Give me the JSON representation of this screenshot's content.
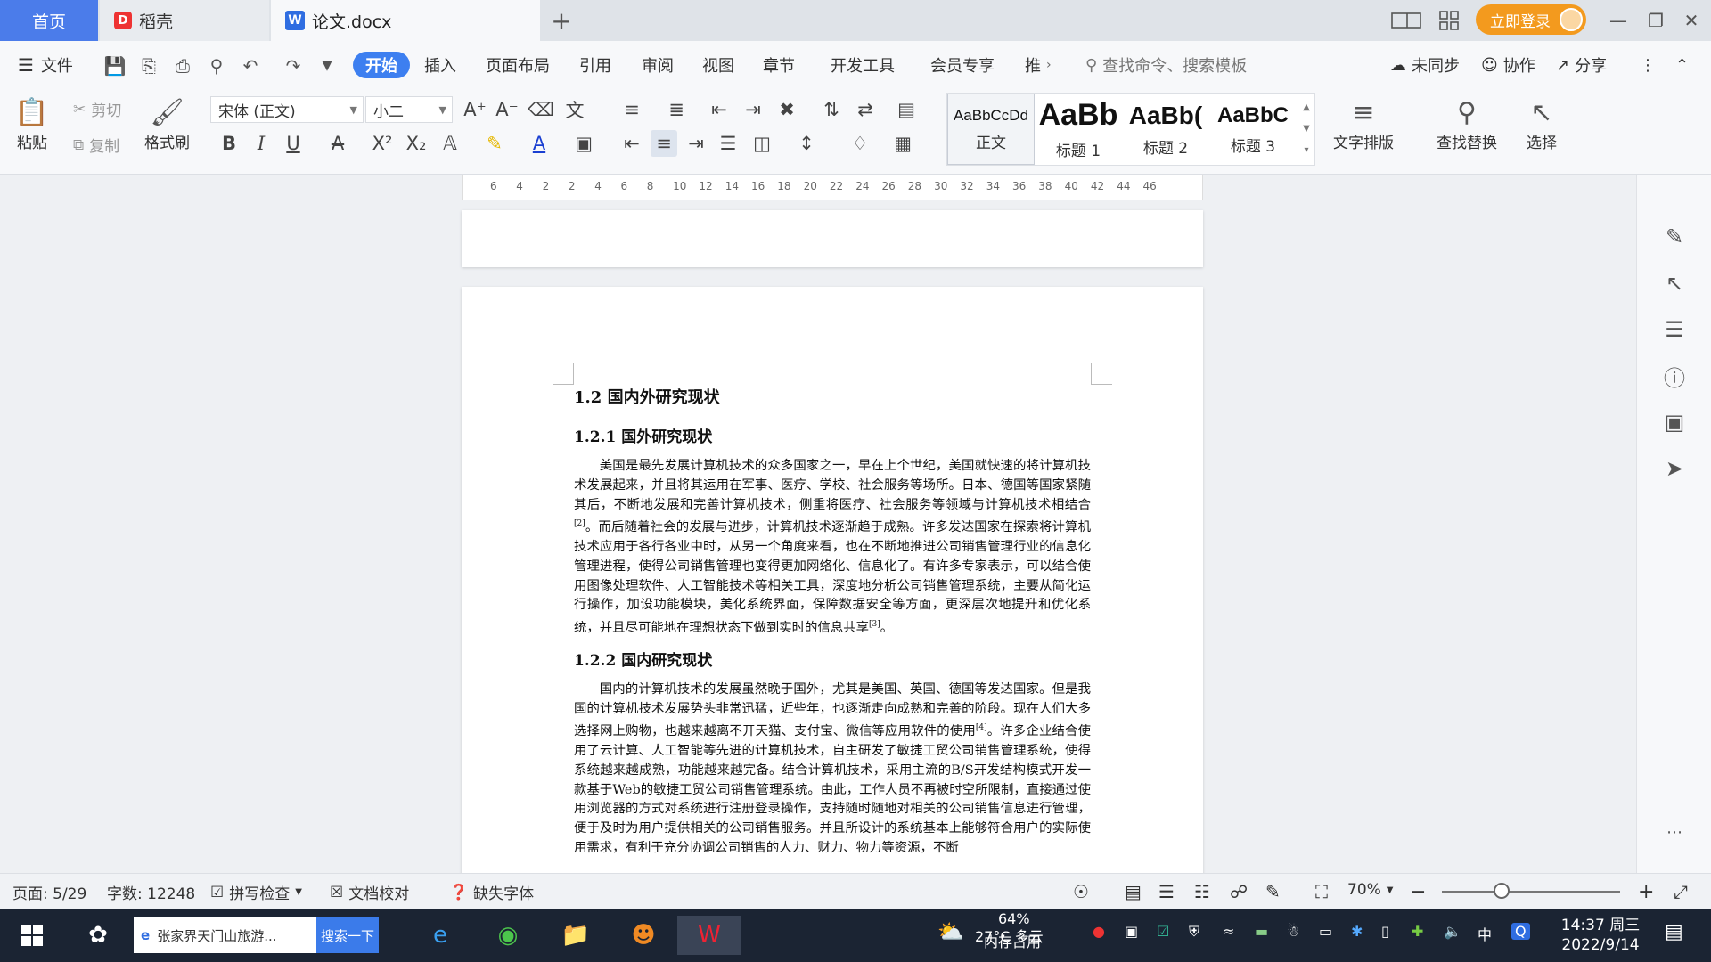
{
  "tabs": {
    "home": "首页",
    "daoke": "稻壳",
    "doc": "论文.docx"
  },
  "titlebar": {
    "login": "立即登录"
  },
  "menu": {
    "file": "文件",
    "start": "开始",
    "insert": "插入",
    "layout": "页面布局",
    "reference": "引用",
    "review": "审阅",
    "view": "视图",
    "chapter": "章节",
    "devtools": "开发工具",
    "member": "会员专享",
    "more": "推",
    "search_cmd": "查找命令、搜索模板",
    "unsync": "未同步",
    "collab": "协作",
    "share": "分享"
  },
  "ribbon": {
    "paste": "粘贴",
    "cut": "剪切",
    "copy": "复制",
    "format_painter": "格式刷",
    "font_name": "宋体 (正文)",
    "font_size": "小二",
    "styles": [
      {
        "sample": "AaBbCcDd",
        "name": "正文"
      },
      {
        "sample": "AaBb",
        "name": "标题 1"
      },
      {
        "sample": "AaBb(",
        "name": "标题 2"
      },
      {
        "sample": "AaBbC",
        "name": "标题 3"
      }
    ],
    "text_layout": "文字排版",
    "find_replace": "查找替换",
    "select": "选择"
  },
  "ruler": {
    "ticks": [
      "6",
      "4",
      "2",
      "2",
      "4",
      "6",
      "8",
      "10",
      "12",
      "14",
      "16",
      "18",
      "20",
      "22",
      "24",
      "26",
      "28",
      "30",
      "32",
      "34",
      "36",
      "38",
      "40",
      "42",
      "44",
      "46"
    ]
  },
  "document": {
    "h_1_2": "1.2 国内外研究现状",
    "h_1_2_1": "1.2.1 国外研究现状",
    "p1_a": "美国是最先发展计算机技术的众多国家之一，早在上个世纪，美国就快速的将计算机技术发展起来，并且将其运用在军事、医疗、学校、社会服务等场所。日本、德国等国家紧随其后，不断地发展和完善计算机技术，侧重将医疗、社会服务等领域与计算机技术相结合",
    "p1_ref1": "[2]",
    "p1_b": "。而后随着社会的发展与进步，计算机技术逐渐趋于成熟。许多发达国家在探索将计算机技术应用于各行各业中时，从另一个角度来看，也在不断地推进公司销售管理行业的信息化管理进程，使得公司销售管理也变得更加网络化、信息化了。有许多专家表示，可以结合使用图像处理软件、人工智能技术等相关工具，深度地分析公司销售管理系统，主要从简化运行操作，加设功能模块，美化系统界面，保障数据安全等方面，更深层次地提升和优化系统，并且尽可能地在理想状态下做到实时的信息共享",
    "p1_ref2": "[3]",
    "p1_c": "。",
    "h_1_2_2": "1.2.2 国内研究现状",
    "p2_a": "国内的计算机技术的发展虽然晚于国外，尤其是美国、英国、德国等发达国家。但是我国的计算机技术发展势头非常迅猛，近些年，也逐渐走向成熟和完善的阶段。现在人们大多选择网上购物，也越来越离不开天猫、支付宝、微信等应用软件的使用",
    "p2_ref1": "[4]",
    "p2_b": "。许多企业结合使用了云计算、人工智能等先进的计算机技术，自主研发了敏捷工贸公司销售管理系统，使得系统越来越成熟，功能越来越完备。结合计算机技术，采用主流的B/S开发结构模式开发一款基于Web的敏捷工贸公司销售管理系统。由此，工作人员不再被时空所限制，直接通过使用浏览器的方式对系统进行注册登录操作，支持随时随地对相关的公司销售信息进行管理，便于及时为用户提供相关的公司销售服务。并且所设计的系统基本上能够符合用户的实际使用需求，有利于充分协调公司销售的人力、财力、物力等资源，不断"
  },
  "status": {
    "page": "页面: 5/29",
    "words": "字数: 12248",
    "spell": "拼写检查",
    "proof": "文档校对",
    "missing_font": "缺失字体",
    "zoom": "70%"
  },
  "taskbar": {
    "search_text": "张家界天门山旅游...",
    "search_btn": "搜索一下",
    "weather": "27°C 多云",
    "mem_pct": "64%",
    "mem_label": "内存占用",
    "ime": "中",
    "time": "14:37 周三",
    "date": "2022/9/14"
  }
}
